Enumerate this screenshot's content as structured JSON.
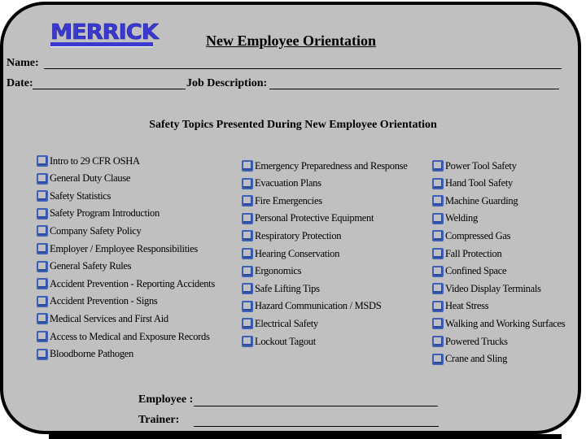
{
  "logo": {
    "text": "MERRICK",
    "color": "#3a3ad0"
  },
  "header": {
    "title": "New Employee Orientation"
  },
  "fields": {
    "name_label": "Name:",
    "date_label": "Date:",
    "job_label": "Job Description:"
  },
  "section": {
    "title": "Safety Topics Presented During New Employee Orientation"
  },
  "topics": {
    "col1": [
      "Intro to 29 CFR OSHA",
      "General Duty Clause",
      "Safety Statistics",
      "Safety Program Introduction",
      "Company Safety Policy",
      "Employer / Employee Responsibilities",
      "General Safety Rules",
      "Accident Prevention - Reporting Accidents",
      "Accident Prevention - Signs",
      "Medical Services and First Aid",
      "Access to Medical and Exposure Records",
      "Bloodborne Pathogen"
    ],
    "col2": [
      "Emergency Preparedness and Response",
      "Evacuation Plans",
      "Fire Emergencies",
      "Personal Protective Equipment",
      "Respiratory Protection",
      "Hearing Conservation",
      "Ergonomics",
      "Safe Lifting Tips",
      "Hazard Communication / MSDS",
      "Electrical Safety",
      "Lockout Tagout"
    ],
    "col3": [
      "Power Tool Safety",
      "Hand Tool Safety",
      "Machine Guarding",
      "Welding",
      "Compressed Gas",
      "Fall Protection",
      "Confined Space",
      "Video Display Terminals",
      "Heat Stress",
      "Walking and Working Surfaces",
      "Powered Trucks",
      "Crane and Sling"
    ],
    "checkbox_color": "#3d5fb8"
  },
  "signatures": {
    "employee_label": "Employee :",
    "trainer_label": "Trainer:"
  }
}
